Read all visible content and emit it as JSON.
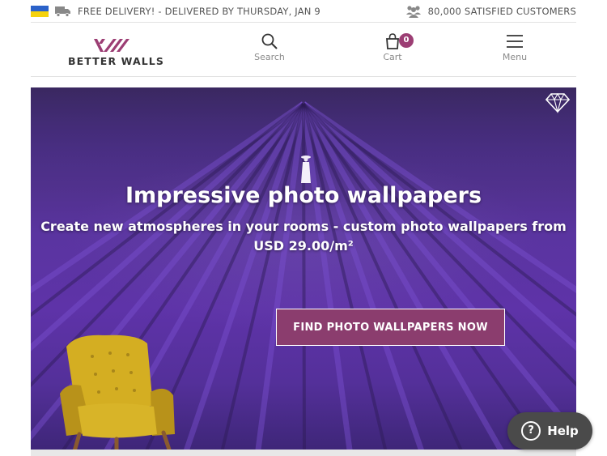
{
  "topbar": {
    "delivery_text": "FREE DELIVERY! - DELIVERED BY THURSDAY, JAN 9",
    "customers_text": "80,000 SATISFIED CUSTOMERS"
  },
  "header": {
    "logo_text": "BETTER WALLS",
    "nav": {
      "search_label": "Search",
      "cart_label": "Cart",
      "cart_count": "0",
      "menu_label": "Menu"
    }
  },
  "hero": {
    "title": "Impressive photo wallpapers",
    "subtitle_line1": "Create new atmospheres in your rooms - custom photo wallpapers from",
    "subtitle_line2": "USD 29.00/m²",
    "cta_label": "FIND PHOTO WALLPAPERS NOW"
  },
  "help": {
    "label": "Help",
    "icon": "question-icon"
  },
  "colors": {
    "brand": "#9c3e74",
    "cta_bg": "#8b3d6e",
    "hero_purple": "#5e33a8",
    "help_bg": "#4a4a4a"
  },
  "icons": [
    "ukraine-flag-icon",
    "truck-icon",
    "customers-icon",
    "search-icon",
    "bag-icon",
    "menu-icon",
    "diamond-icon"
  ]
}
